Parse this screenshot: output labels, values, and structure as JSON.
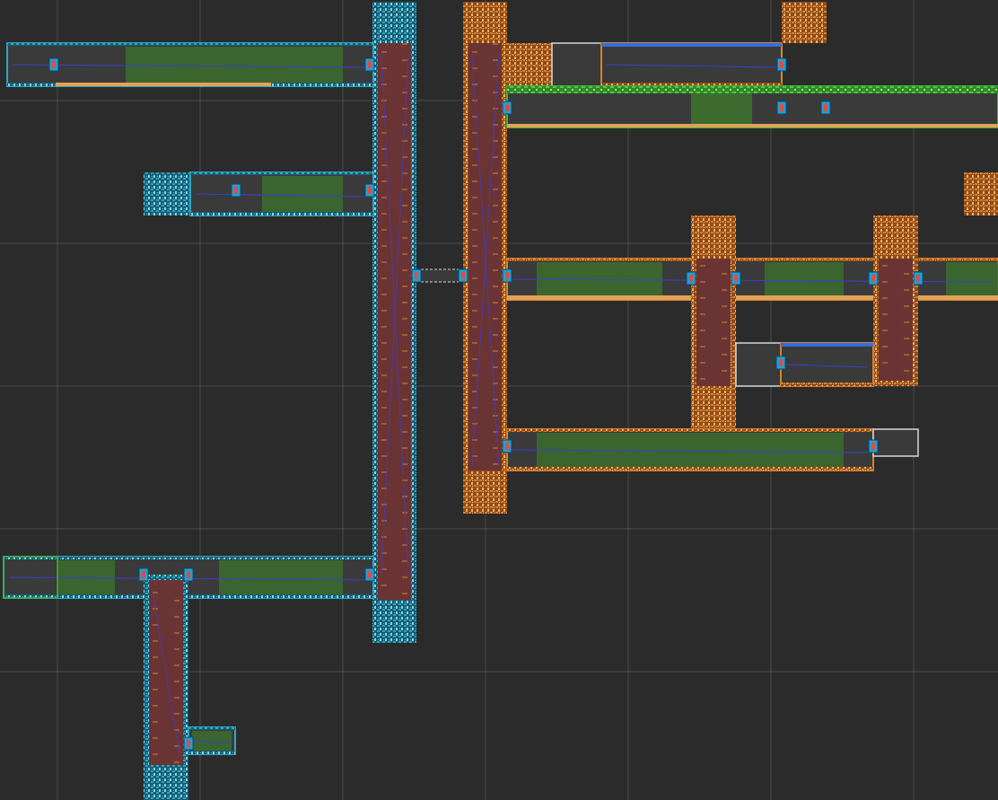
{
  "editor": {
    "view": "room-map",
    "grid": {
      "visible": true,
      "color": "#4a4a4a"
    }
  },
  "colors": {
    "background": "#2b2b2b",
    "cyan_tile": "#2aa7c4",
    "orange_tile": "#d8812e",
    "room_interior": "#3a3a3a",
    "shaft_interior": "#6b3434",
    "corridor_fill": "#3c6a2f",
    "bright_green": "#3fb03a",
    "blue_wall": "#2f6fe0",
    "door": "#1ea0d8",
    "link_line": "#3a3fd0",
    "floor_orange": "#e2a256",
    "white_tile": "#d8d8d8"
  },
  "legend": {
    "areas": [
      {
        "name": "cyan-area"
      },
      {
        "name": "orange-area"
      }
    ]
  }
}
